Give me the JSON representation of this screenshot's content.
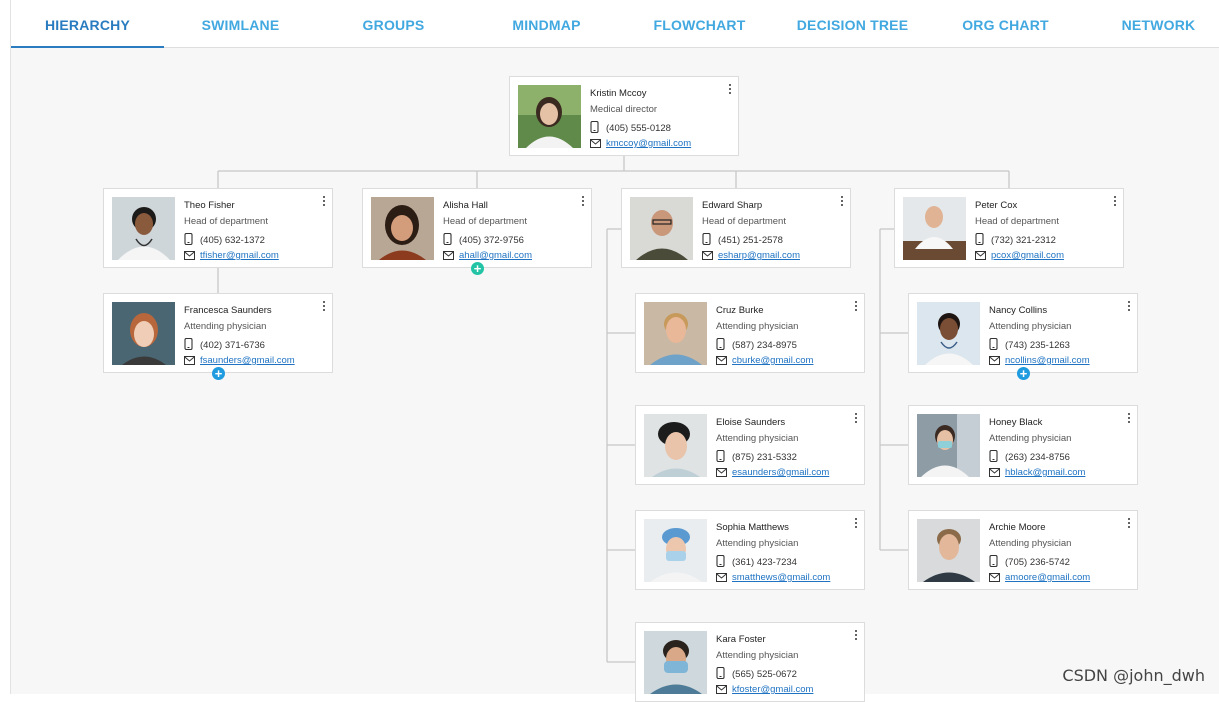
{
  "tabs": [
    {
      "label": "HIERARCHY",
      "active": true
    },
    {
      "label": "SWIMLANE",
      "active": false
    },
    {
      "label": "GROUPS",
      "active": false
    },
    {
      "label": "MINDMAP",
      "active": false
    },
    {
      "label": "FLOWCHART",
      "active": false
    },
    {
      "label": "DECISION TREE",
      "active": false
    },
    {
      "label": "ORG CHART",
      "active": false
    },
    {
      "label": "NETWORK",
      "active": false
    }
  ],
  "people": {
    "root": {
      "name": "Kristin Mccoy",
      "title": "Medical director",
      "phone": "(405) 555-0128",
      "email": "kmccoy@gmail.com"
    },
    "theo": {
      "name": "Theo Fisher",
      "title": "Head of department",
      "phone": "(405) 632-1372",
      "email": "tfisher@gmail.com"
    },
    "alisha": {
      "name": "Alisha Hall",
      "title": "Head of department",
      "phone": "(405) 372-9756",
      "email": "ahall@gmail.com"
    },
    "edward": {
      "name": "Edward Sharp",
      "title": "Head of department",
      "phone": "(451) 251-2578",
      "email": "esharp@gmail.com"
    },
    "peter": {
      "name": "Peter Cox",
      "title": "Head of department",
      "phone": "(732) 321-2312",
      "email": "pcox@gmail.com"
    },
    "francesca": {
      "name": "Francesca Saunders",
      "title": "Attending physician",
      "phone": "(402) 371-6736",
      "email": "fsaunders@gmail.com"
    },
    "cruz": {
      "name": "Cruz Burke",
      "title": "Attending physician",
      "phone": "(587) 234-8975",
      "email": "cburke@gmail.com"
    },
    "eloise": {
      "name": "Eloise Saunders",
      "title": "Attending physician",
      "phone": "(875) 231-5332",
      "email": "esaunders@gmail.com"
    },
    "sophia": {
      "name": "Sophia Matthews",
      "title": "Attending physician",
      "phone": "(361) 423-7234",
      "email": "smatthews@gmail.com"
    },
    "kara": {
      "name": "Kara Foster",
      "title": "Attending physician",
      "phone": "(565) 525-0672",
      "email": "kfoster@gmail.com"
    },
    "nancy": {
      "name": "Nancy Collins",
      "title": "Attending physician",
      "phone": "(743) 235-1263",
      "email": "ncollins@gmail.com"
    },
    "honey": {
      "name": "Honey Black",
      "title": "Attending physician",
      "phone": "(263) 234-8756",
      "email": "hblack@gmail.com"
    },
    "archie": {
      "name": "Archie Moore",
      "title": "Attending physician",
      "phone": "(705) 236-5742",
      "email": "amoore@gmail.com"
    }
  },
  "expand_buttons": {
    "symbol": "+"
  },
  "colors": {
    "accent": "#2a7cc0",
    "tab_text": "#42a8e0",
    "link": "#1f73c2",
    "plus_green": "#23c4a6",
    "plus_blue": "#1f9be0"
  },
  "watermark": "CSDN @john_dwh"
}
